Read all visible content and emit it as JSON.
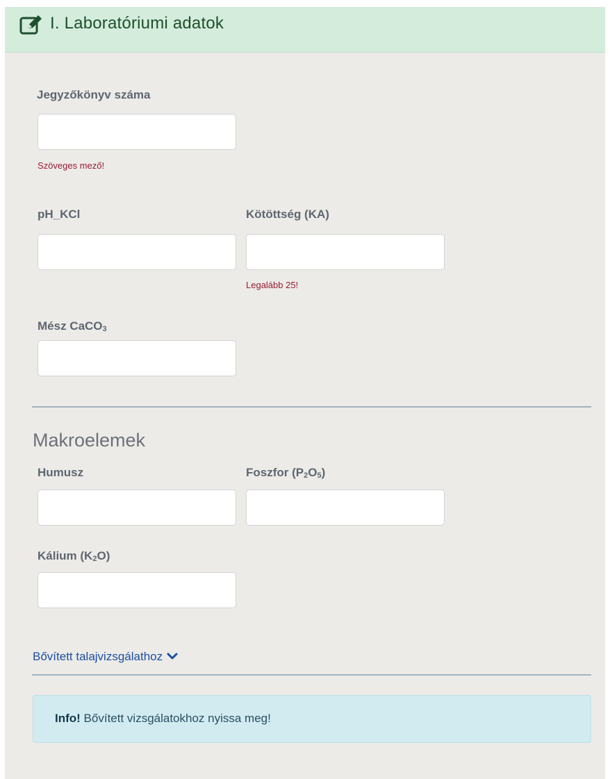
{
  "header": {
    "title": "I. Laboratóriumi adatok",
    "icon": "edit-icon",
    "bg_color": "#d4ecdc"
  },
  "fields": {
    "jegyzokonyv": {
      "label": "Jegyzőkönyv száma",
      "value": "",
      "error": "Szöveges mező!"
    },
    "ph": {
      "label": "pH_KCl",
      "value": ""
    },
    "kototts": {
      "label": "Kötöttség (KA)",
      "value": "",
      "error": "Legalább 25!"
    },
    "mesz": {
      "label_main": "Mész CaCO",
      "label_sub": "3",
      "value": ""
    }
  },
  "macro": {
    "title": "Makroelemek",
    "humusz": {
      "label": "Humusz",
      "value": ""
    },
    "foszfor": {
      "label_pre": "Foszfor (P",
      "sub1": "2",
      "label_mid": "O",
      "sub2": "5",
      "label_post": ")",
      "value": ""
    },
    "kalium": {
      "label_pre": "Kálium (K",
      "sub1": "2",
      "label_post": "O)",
      "value": ""
    }
  },
  "expand": {
    "label": "Bővített talajvizsgálathoz",
    "icon": "chevron-down-icon"
  },
  "alert": {
    "strong": "Info!",
    "text": " Bővített vizsgálatokhoz nyissa meg!"
  },
  "colors": {
    "error": "#9a1b32",
    "link": "#1c4fa3",
    "info_bg": "#d2ebf1",
    "panel_bg": "#ecebe8"
  }
}
